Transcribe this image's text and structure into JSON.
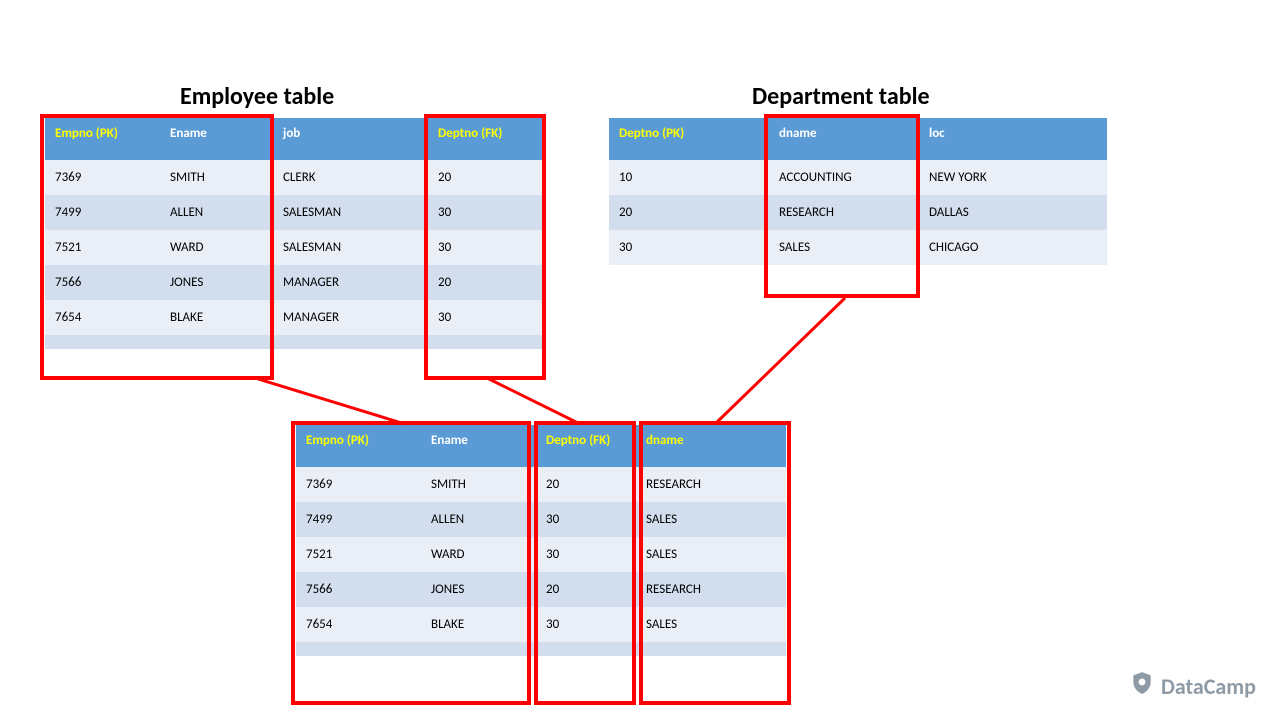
{
  "titles": {
    "employee": "Employee table",
    "department": "Department table"
  },
  "employee": {
    "headers": {
      "empno": "Empno (PK)",
      "ename": "Ename",
      "job": "job",
      "deptno": "Deptno (FK)"
    },
    "rows": [
      {
        "empno": "7369",
        "ename": "SMITH",
        "job": "CLERK",
        "deptno": "20"
      },
      {
        "empno": "7499",
        "ename": "ALLEN",
        "job": "SALESMAN",
        "deptno": "30"
      },
      {
        "empno": "7521",
        "ename": "WARD",
        "job": "SALESMAN",
        "deptno": "30"
      },
      {
        "empno": "7566",
        "ename": "JONES",
        "job": "MANAGER",
        "deptno": "20"
      },
      {
        "empno": "7654",
        "ename": "BLAKE",
        "job": "MANAGER",
        "deptno": "30"
      }
    ]
  },
  "department": {
    "headers": {
      "deptno": "Deptno (PK)",
      "dname": "dname",
      "loc": "loc"
    },
    "rows": [
      {
        "deptno": "10",
        "dname": "ACCOUNTING",
        "loc": "NEW YORK"
      },
      {
        "deptno": "20",
        "dname": "RESEARCH",
        "loc": "DALLAS"
      },
      {
        "deptno": "30",
        "dname": "SALES",
        "loc": "CHICAGO"
      }
    ]
  },
  "joined": {
    "headers": {
      "empno": "Empno (PK)",
      "ename": "Ename",
      "deptno": "Deptno (FK)",
      "dname": "dname"
    },
    "rows": [
      {
        "empno": "7369",
        "ename": "SMITH",
        "deptno": "20",
        "dname": "RESEARCH"
      },
      {
        "empno": "7499",
        "ename": "ALLEN",
        "deptno": "30",
        "dname": "SALES"
      },
      {
        "empno": "7521",
        "ename": "WARD",
        "deptno": "30",
        "dname": "SALES"
      },
      {
        "empno": "7566",
        "ename": "JONES",
        "deptno": "20",
        "dname": "RESEARCH"
      },
      {
        "empno": "7654",
        "ename": "BLAKE",
        "deptno": "30",
        "dname": "SALES"
      }
    ]
  },
  "logo": {
    "text": "DataCamp"
  },
  "colors": {
    "header_bg": "#5B9BD5",
    "highlight_fg": "#FFFF00",
    "row_odd": "#EAEFF7",
    "row_even": "#D2DEEE",
    "accent": "#FF0000"
  }
}
